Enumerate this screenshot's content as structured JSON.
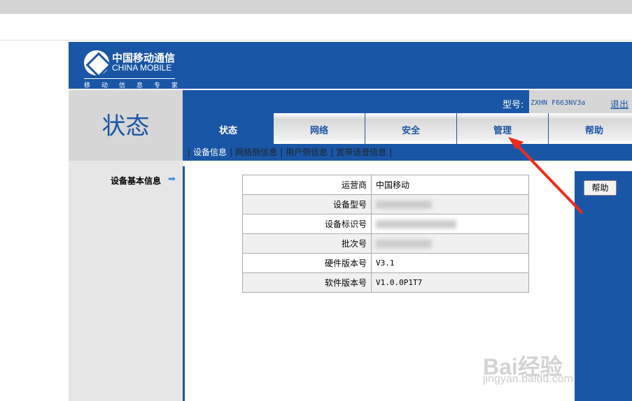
{
  "header": {
    "logo_cn": "中国移动通信",
    "logo_en": "CHINA MOBILE",
    "slogan": "移动信息专家"
  },
  "page_title": "状态",
  "model_label": "型号:",
  "model_value": "ZXHN F663NV3a",
  "logout": "退出",
  "tabs": [
    {
      "label": "状态",
      "active": true
    },
    {
      "label": "网络"
    },
    {
      "label": "安全"
    },
    {
      "label": "管理"
    },
    {
      "label": "帮助"
    }
  ],
  "subnav": [
    "设备信息",
    "网络侧信息",
    "用户侧信息",
    "宽带语音信息"
  ],
  "section_label": "设备基本信息",
  "help_button": "帮助",
  "table": [
    {
      "key": "运营商",
      "value": "中国移动"
    },
    {
      "key": "设备型号",
      "value": null
    },
    {
      "key": "设备标识号",
      "value": null
    },
    {
      "key": "批次号",
      "value": null
    },
    {
      "key": "硬件版本号",
      "value": "V3.1"
    },
    {
      "key": "软件版本号",
      "value": "V1.0.0P1T7"
    }
  ],
  "watermark": {
    "brand": "Bai经验",
    "url": "jingyan.baidu.com"
  }
}
